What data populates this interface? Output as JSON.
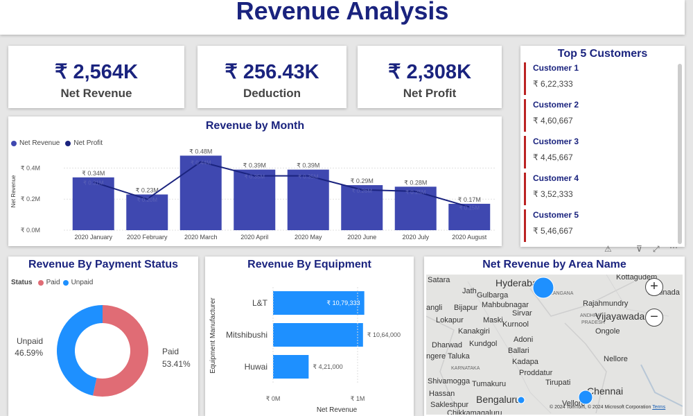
{
  "title": "Revenue Analysis",
  "kpis": [
    {
      "value": "₹ 2,564K",
      "label": "Net Revenue"
    },
    {
      "value": "₹ 256.43K",
      "label": "Deduction"
    },
    {
      "value": "₹ 2,308K",
      "label": "Net Profit"
    }
  ],
  "top_customers": {
    "title": "Top 5 Customers",
    "items": [
      {
        "name": "Customer 1",
        "amount": "₹ 6,22,333"
      },
      {
        "name": "Customer 2",
        "amount": "₹ 4,60,667"
      },
      {
        "name": "Customer 3",
        "amount": "₹ 4,45,667"
      },
      {
        "name": "Customer 4",
        "amount": "₹ 3,52,333"
      },
      {
        "name": "Customer 5",
        "amount": "₹ 5,46,667"
      }
    ]
  },
  "colors": {
    "bar": "#3f48b0",
    "line": "#1a237e",
    "paid": "#e06c75",
    "unpaid": "#1e90ff",
    "equipment": "#1e90ff",
    "accent": "#1a237e",
    "bubble": "#1e90ff"
  },
  "chart_data": [
    {
      "type": "bar",
      "title": "Revenue by Month",
      "ylabel": "Net Revenue",
      "categories": [
        "2020 January",
        "2020 February",
        "2020 March",
        "2020 April",
        "2020 May",
        "2020 June",
        "2020 July",
        "2020 August"
      ],
      "series": [
        {
          "name": "Net Revenue",
          "values": [
            0.34,
            0.23,
            0.48,
            0.39,
            0.39,
            0.29,
            0.28,
            0.17
          ],
          "labels": [
            "₹ 0.34M",
            "₹ 0.23M",
            "₹ 0.48M",
            "₹ 0.39M",
            "₹ 0.39M",
            "₹ 0.29M",
            "₹ 0.28M",
            "₹ 0.17M"
          ]
        },
        {
          "name": "Net Profit",
          "type": "line",
          "values": [
            0.31,
            0.2,
            0.44,
            0.35,
            0.35,
            0.26,
            0.25,
            0.15
          ],
          "labels": [
            "₹ 0.31M",
            "₹ 0.20M",
            "₹ 0.44M",
            "₹ 0.35M",
            "₹ 0.35M",
            "₹ 0.26M",
            "₹ 0.25M",
            "₹ 0.15M"
          ]
        }
      ],
      "yticks": [
        "₹ 0.0M",
        "₹ 0.2M",
        "₹ 0.4M"
      ],
      "ylim": [
        0,
        0.5
      ]
    },
    {
      "type": "pie",
      "title": "Revenue By Payment Status",
      "legend_title": "Status",
      "categories": [
        "Paid",
        "Unpaid"
      ],
      "values": [
        53.41,
        46.59
      ],
      "labels": [
        "53.41%",
        "46.59%"
      ]
    },
    {
      "type": "bar",
      "title": "Revenue By Equipment",
      "xlabel": "Net Revenue",
      "ylabel": "Equipment Manufacturer",
      "categories": [
        "L&T",
        "Mitshibushi",
        "Huwai"
      ],
      "values": [
        1079333,
        1064000,
        421000
      ],
      "labels": [
        "₹ 10,79,333",
        "₹ 10,64,000",
        "₹ 4,21,000"
      ],
      "xticks": [
        "₹ 0M",
        "₹ 1M"
      ],
      "xlim": [
        0,
        1000000
      ]
    }
  ],
  "map": {
    "title": "Net Revenue by Area Name",
    "labels": [
      "Satara",
      "Jath",
      "Hyderabad",
      "Kottagudem",
      "Gulbarga",
      "TELANGANA",
      "angli",
      "Bijapur",
      "Mahbubnagar",
      "Rajahmundry",
      "Kakinada",
      "Lokapur",
      "Maski",
      "Sirvar",
      "ANDHRA",
      "PRADESH",
      "Vijayawada",
      "Kanakgiri",
      "Kurnool",
      "Ongole",
      "Kundgol",
      "Adoni",
      "Dharwad",
      "Ballari",
      "Kadapa",
      "ngere Taluka",
      "Proddatur",
      "Nellore",
      "KARNATAKA",
      "Tirupati",
      "Shivamogga",
      "Tumakuru",
      "Chennai",
      "Bengaluru",
      "Vellore",
      "Hassan",
      "Sakleshpur",
      "Chikkamagaluru"
    ],
    "credit": "© 2024 TomTom, © 2024 Microsoft Corporation",
    "terms": "Terms",
    "zoom_in": "+",
    "zoom_out": "−"
  }
}
